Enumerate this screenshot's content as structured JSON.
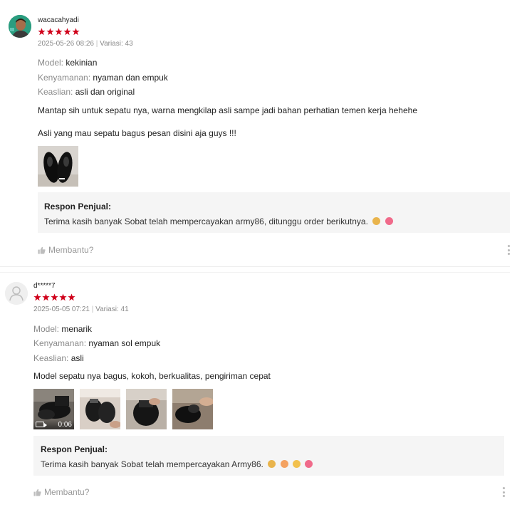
{
  "colors": {
    "star": "#d0011b",
    "seller_box": "#f5f5f5",
    "muted": "#888888"
  },
  "reviews": [
    {
      "username": "wacacahyadi",
      "rating": 5,
      "date": "2025-05-26 08:26",
      "variation": "Variasi: 43",
      "attributes": [
        {
          "key": "Model:",
          "value": "kekinian"
        },
        {
          "key": "Kenyamanan:",
          "value": "nyaman dan empuk"
        },
        {
          "key": "Keaslian:",
          "value": "asli dan original"
        }
      ],
      "text_lines": [
        "Mantap sih untuk sepatu nya, warna mengkilap asli sampe jadi bahan perhatian temen kerja hehehe",
        "Asli yang mau sepatu bagus pesan disini aja guys !!!"
      ],
      "media": [
        {
          "type": "photo",
          "icon": "shoes-photo"
        }
      ],
      "seller_response": {
        "title": "Respon Penjual:",
        "text": "Terima kasih banyak Sobat telah mempercayakan army86, ditunggu order berikutnya."
      },
      "helpful_label": "Membantu?"
    },
    {
      "username": "d*****7",
      "rating": 5,
      "date": "2025-05-05 07:21",
      "variation": "Variasi: 41",
      "attributes": [
        {
          "key": "Model:",
          "value": "menarik"
        },
        {
          "key": "Kenyamanan:",
          "value": "nyaman sol empuk"
        },
        {
          "key": "Keaslian:",
          "value": "asli"
        }
      ],
      "text_lines": [
        "Model sepatu nya bagus, kokoh, berkualitas, pengiriman cepat"
      ],
      "media": [
        {
          "type": "video",
          "duration": "0:06"
        },
        {
          "type": "photo"
        },
        {
          "type": "photo"
        },
        {
          "type": "photo"
        }
      ],
      "seller_response": {
        "title": "Respon Penjual:",
        "text": "Terima kasih banyak Sobat telah mempercayakan Army86."
      },
      "helpful_label": "Membantu?"
    }
  ]
}
